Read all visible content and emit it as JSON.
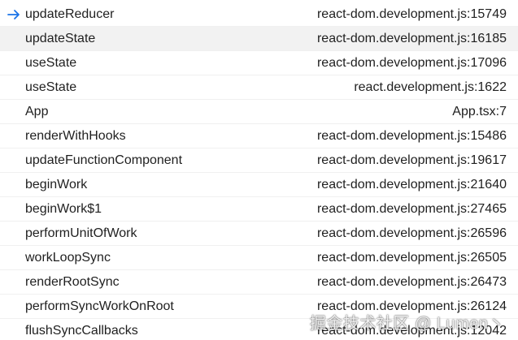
{
  "call_stack": {
    "frames": [
      {
        "name": "updateReducer",
        "location": "react-dom.development.js:15749",
        "current": true
      },
      {
        "name": "updateState",
        "location": "react-dom.development.js:16185",
        "selected": true
      },
      {
        "name": "useState",
        "location": "react-dom.development.js:17096"
      },
      {
        "name": "useState",
        "location": "react.development.js:1622"
      },
      {
        "name": "App",
        "location": "App.tsx:7"
      },
      {
        "name": "renderWithHooks",
        "location": "react-dom.development.js:15486"
      },
      {
        "name": "updateFunctionComponent",
        "location": "react-dom.development.js:19617"
      },
      {
        "name": "beginWork",
        "location": "react-dom.development.js:21640"
      },
      {
        "name": "beginWork$1",
        "location": "react-dom.development.js:27465"
      },
      {
        "name": "performUnitOfWork",
        "location": "react-dom.development.js:26596"
      },
      {
        "name": "workLoopSync",
        "location": "react-dom.development.js:26505"
      },
      {
        "name": "renderRootSync",
        "location": "react-dom.development.js:26473"
      },
      {
        "name": "performSyncWorkOnRoot",
        "location": "react-dom.development.js:26124"
      },
      {
        "name": "flushSyncCallbacks",
        "location": "react-dom.development.js:12042"
      }
    ]
  },
  "icons": {
    "current_frame": "arrow-right-icon"
  },
  "colors": {
    "accent": "#1a73e8",
    "selected_row": "#f2f2f2"
  },
  "watermark": {
    "text": "掘金技术社区 @ Lumen丶"
  }
}
